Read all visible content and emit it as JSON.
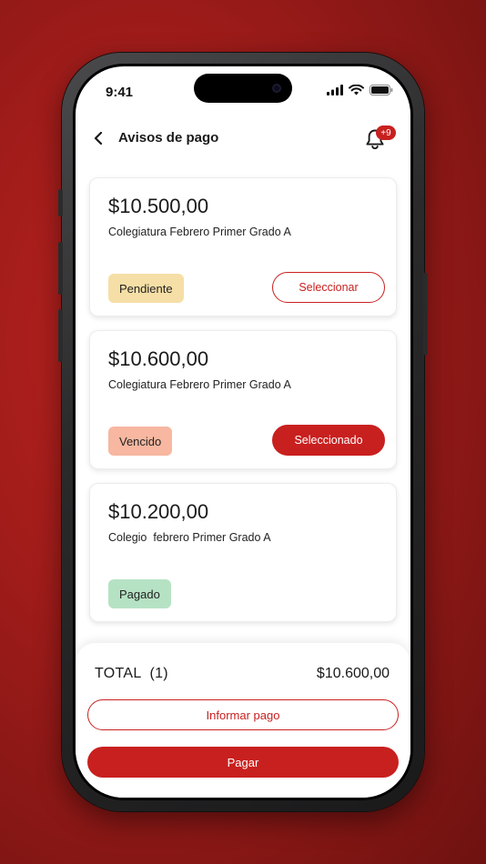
{
  "colors": {
    "accent": "#c8201f",
    "pending": "#f6dfa6",
    "overdue": "#f7b7a0",
    "paid": "#b6e2c4"
  },
  "status_bar": {
    "time": "9:41"
  },
  "header": {
    "title": "Avisos de pago",
    "notification_badge": "+9"
  },
  "invoices": [
    {
      "amount": "$10.500,00",
      "description": "Colegiatura Febrero Primer Grado A",
      "status": "Pendiente",
      "action": "Seleccionar"
    },
    {
      "amount": "$10.600,00",
      "description": "Colegiatura Febrero Primer Grado A",
      "status": "Vencido",
      "action": "Seleccionado"
    },
    {
      "amount": "$10.200,00",
      "description": "Colegio  febrero Primer Grado A",
      "status": "Pagado"
    }
  ],
  "summary": {
    "total_label": "TOTAL  (1)",
    "total_value": "$10.600,00",
    "inform_label": "Informar pago",
    "pay_label": "Pagar"
  }
}
